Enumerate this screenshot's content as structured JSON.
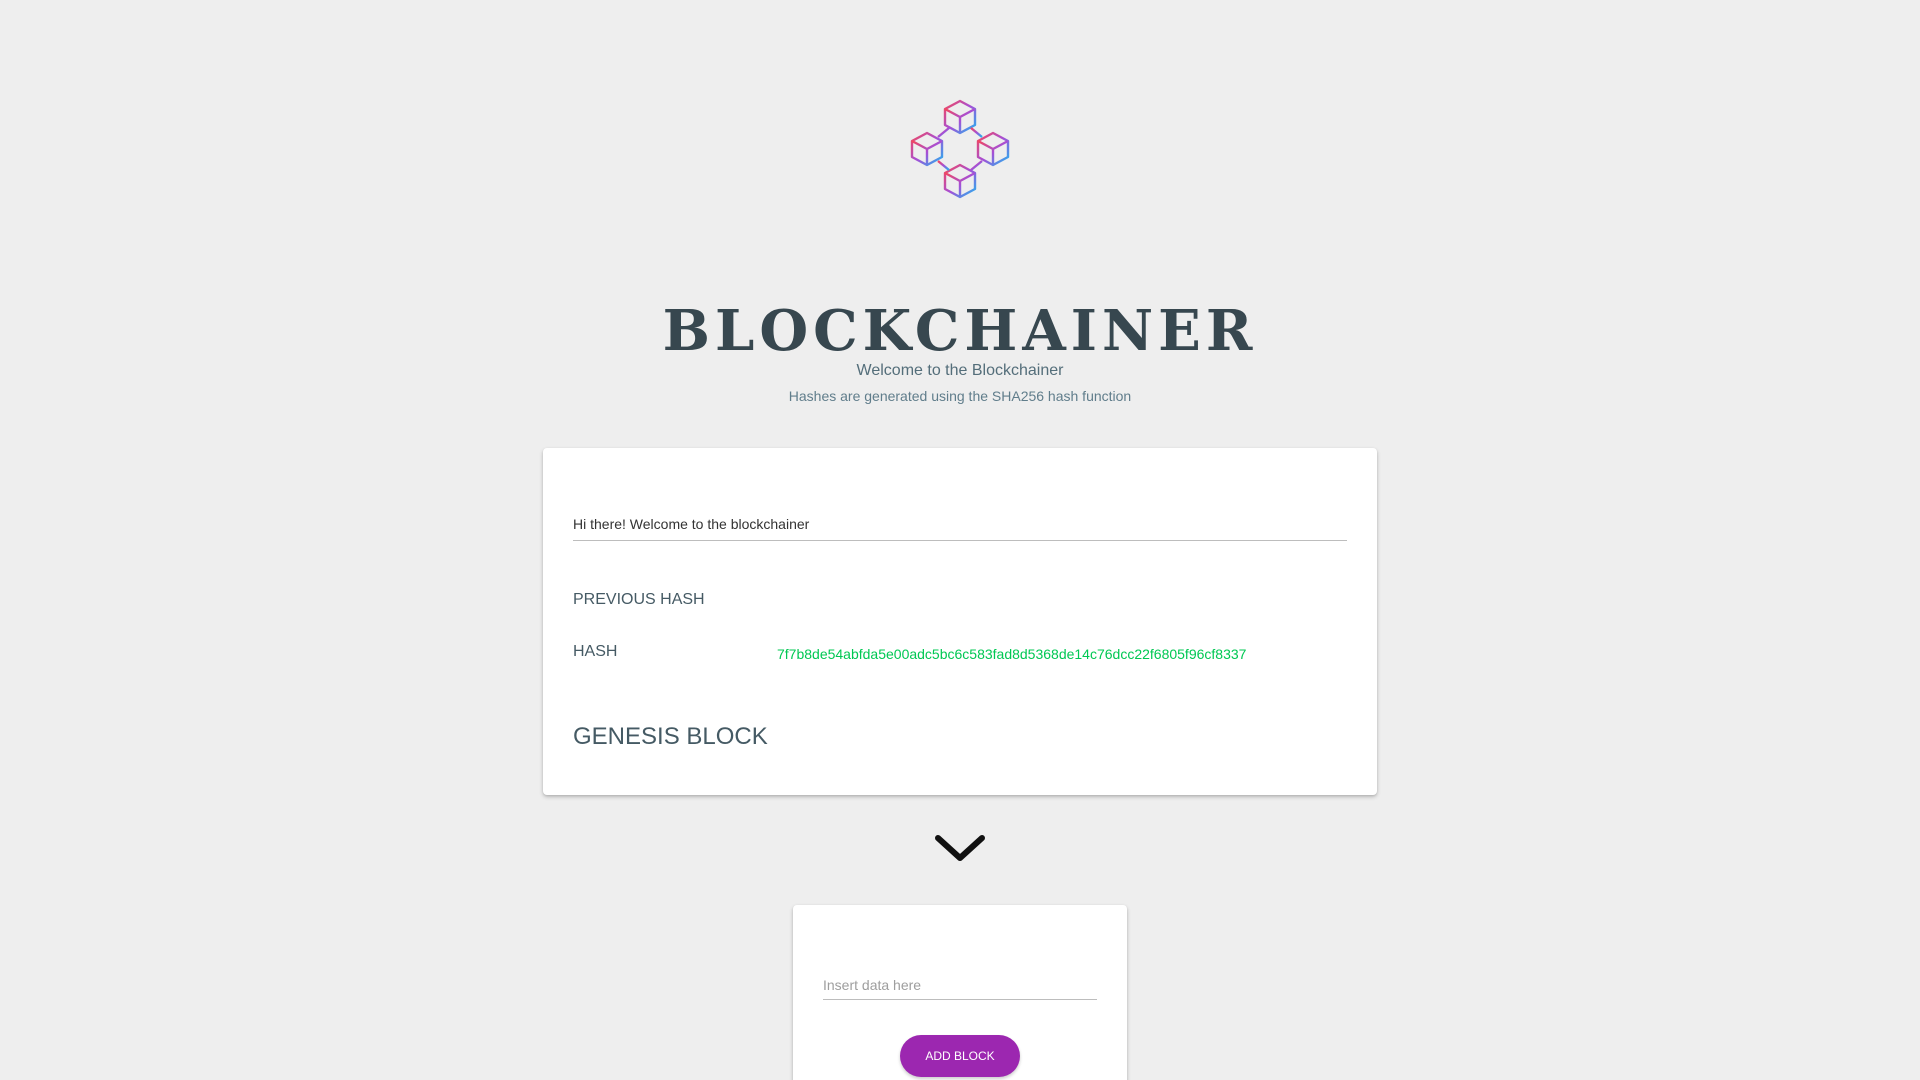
{
  "header": {
    "logo_icon": "blockchain-cubes-logo",
    "title": "BLOCKCHAINER",
    "subtitle": "Welcome to the Blockchainer",
    "description": "Hashes are generated using the SHA256 hash function"
  },
  "blocks": [
    {
      "data": "Hi there! Welcome to the blockchainer",
      "previous_hash_label": "PREVIOUS HASH",
      "previous_hash_value": "",
      "hash_label": "HASH",
      "hash_value": "7f7b8de54abfda5e00adc5bc6c583fad8d5368de14c76dcc22f6805f96cf8337",
      "type": "GENESIS BLOCK"
    }
  ],
  "chain_connector_icon": "chevron-down-icon",
  "add_block": {
    "input_placeholder": "Insert data here",
    "input_value": "",
    "button_label": "ADD BLOCK"
  },
  "colors": {
    "background": "#eeeeee",
    "title": "#37474f",
    "hash": "#00c853",
    "button": "#9c27b0",
    "logo_gradient_start": "#f4475b",
    "logo_gradient_mid": "#a64fd6",
    "logo_gradient_end": "#1fb6f0"
  }
}
